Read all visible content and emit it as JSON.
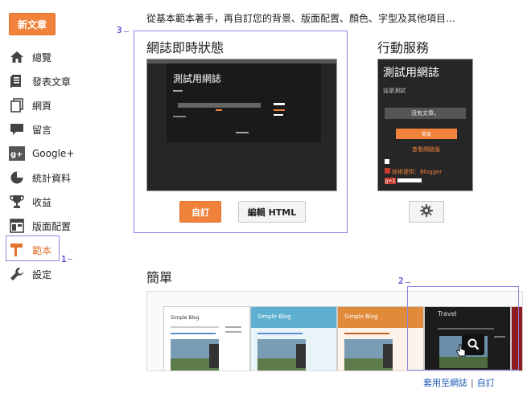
{
  "sidebar": {
    "new_post": "新文章",
    "items": [
      {
        "label": "總覽",
        "icon": "home-icon"
      },
      {
        "label": "發表文章",
        "icon": "posts-icon"
      },
      {
        "label": "網頁",
        "icon": "pages-icon"
      },
      {
        "label": "留言",
        "icon": "comments-icon"
      },
      {
        "label": "Google+",
        "icon": "google-plus-icon"
      },
      {
        "label": "統計資料",
        "icon": "stats-icon"
      },
      {
        "label": "收益",
        "icon": "trophy-icon"
      },
      {
        "label": "版面配置",
        "icon": "layout-icon"
      },
      {
        "label": "範本",
        "icon": "template-icon",
        "active": true
      },
      {
        "label": "設定",
        "icon": "wrench-icon"
      }
    ]
  },
  "tagline": "從基本範本著手，再自訂您的背景、版面配置、顏色、字型及其他項目…",
  "live": {
    "title": "網誌即時狀態",
    "thumb_title": "測試用網誌",
    "customize": "自訂",
    "edit_html": "編輯 HTML"
  },
  "mobile": {
    "title": "行動服務",
    "thumb_title": "測試用網誌",
    "thumb_sub": "這是測試",
    "thumb_btn": "沒有文章。",
    "thumb_home": "首頁",
    "thumb_link": "查看網路版",
    "thumb_provider": "技術提供：Blogger",
    "thumb_share_label": "g+1"
  },
  "simple": {
    "title": "簡單",
    "templates": [
      {
        "name": "Simple Blog"
      },
      {
        "name": "Simple Blog"
      },
      {
        "name": "Simple Blog"
      },
      {
        "name": "Travel"
      }
    ],
    "apply": "套用至網誌",
    "customize": "自訂"
  },
  "annotations": {
    "n1": "1",
    "n2": "2",
    "n3": "3"
  },
  "colors": {
    "accent": "#f0823c",
    "annotation": "#8b86e0",
    "link": "#1a56b0"
  }
}
